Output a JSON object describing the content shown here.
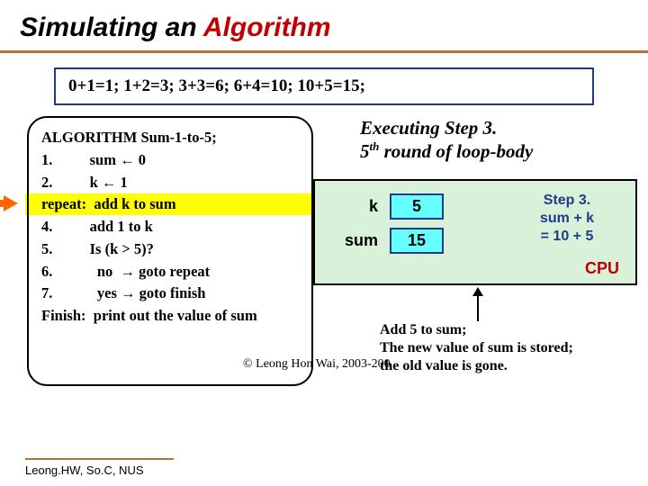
{
  "title": {
    "pre": "Simulating an ",
    "accent": "Algorithm"
  },
  "formula": "0+1=1;  1+2=3;  3+3=6;  6+4=10;  10+5=15;",
  "algo": {
    "header": "ALGORITHM Sum-1-to-5;",
    "lines": [
      "1.          sum ← 0",
      "2.          k ← 1",
      "repeat:  add k to sum",
      "4.          add 1 to k",
      "5.          Is (k > 5)?",
      "6.            no  → goto repeat",
      "7.            yes → goto finish",
      "Finish:  print out the value of sum"
    ]
  },
  "exec": {
    "line1": "Executing Step 3.",
    "line2_pre": "  5",
    "line2_sup": "th",
    "line2_post": " round of loop-body"
  },
  "cpu": {
    "k_label": "k",
    "k_value": "5",
    "sum_label": "sum",
    "sum_value": "15",
    "step3_l1": "Step 3.",
    "step3_l2": "sum + k",
    "step3_l3": "= 10 + 5",
    "label": "CPU"
  },
  "note": {
    "l1": "Add 5 to sum;",
    "l2": "The new value of sum is stored;",
    "l3": "the old value is gone."
  },
  "copyright": "© Leong Hon Wai, 2003-200",
  "footer": "Leong.HW, So.C, NUS"
}
